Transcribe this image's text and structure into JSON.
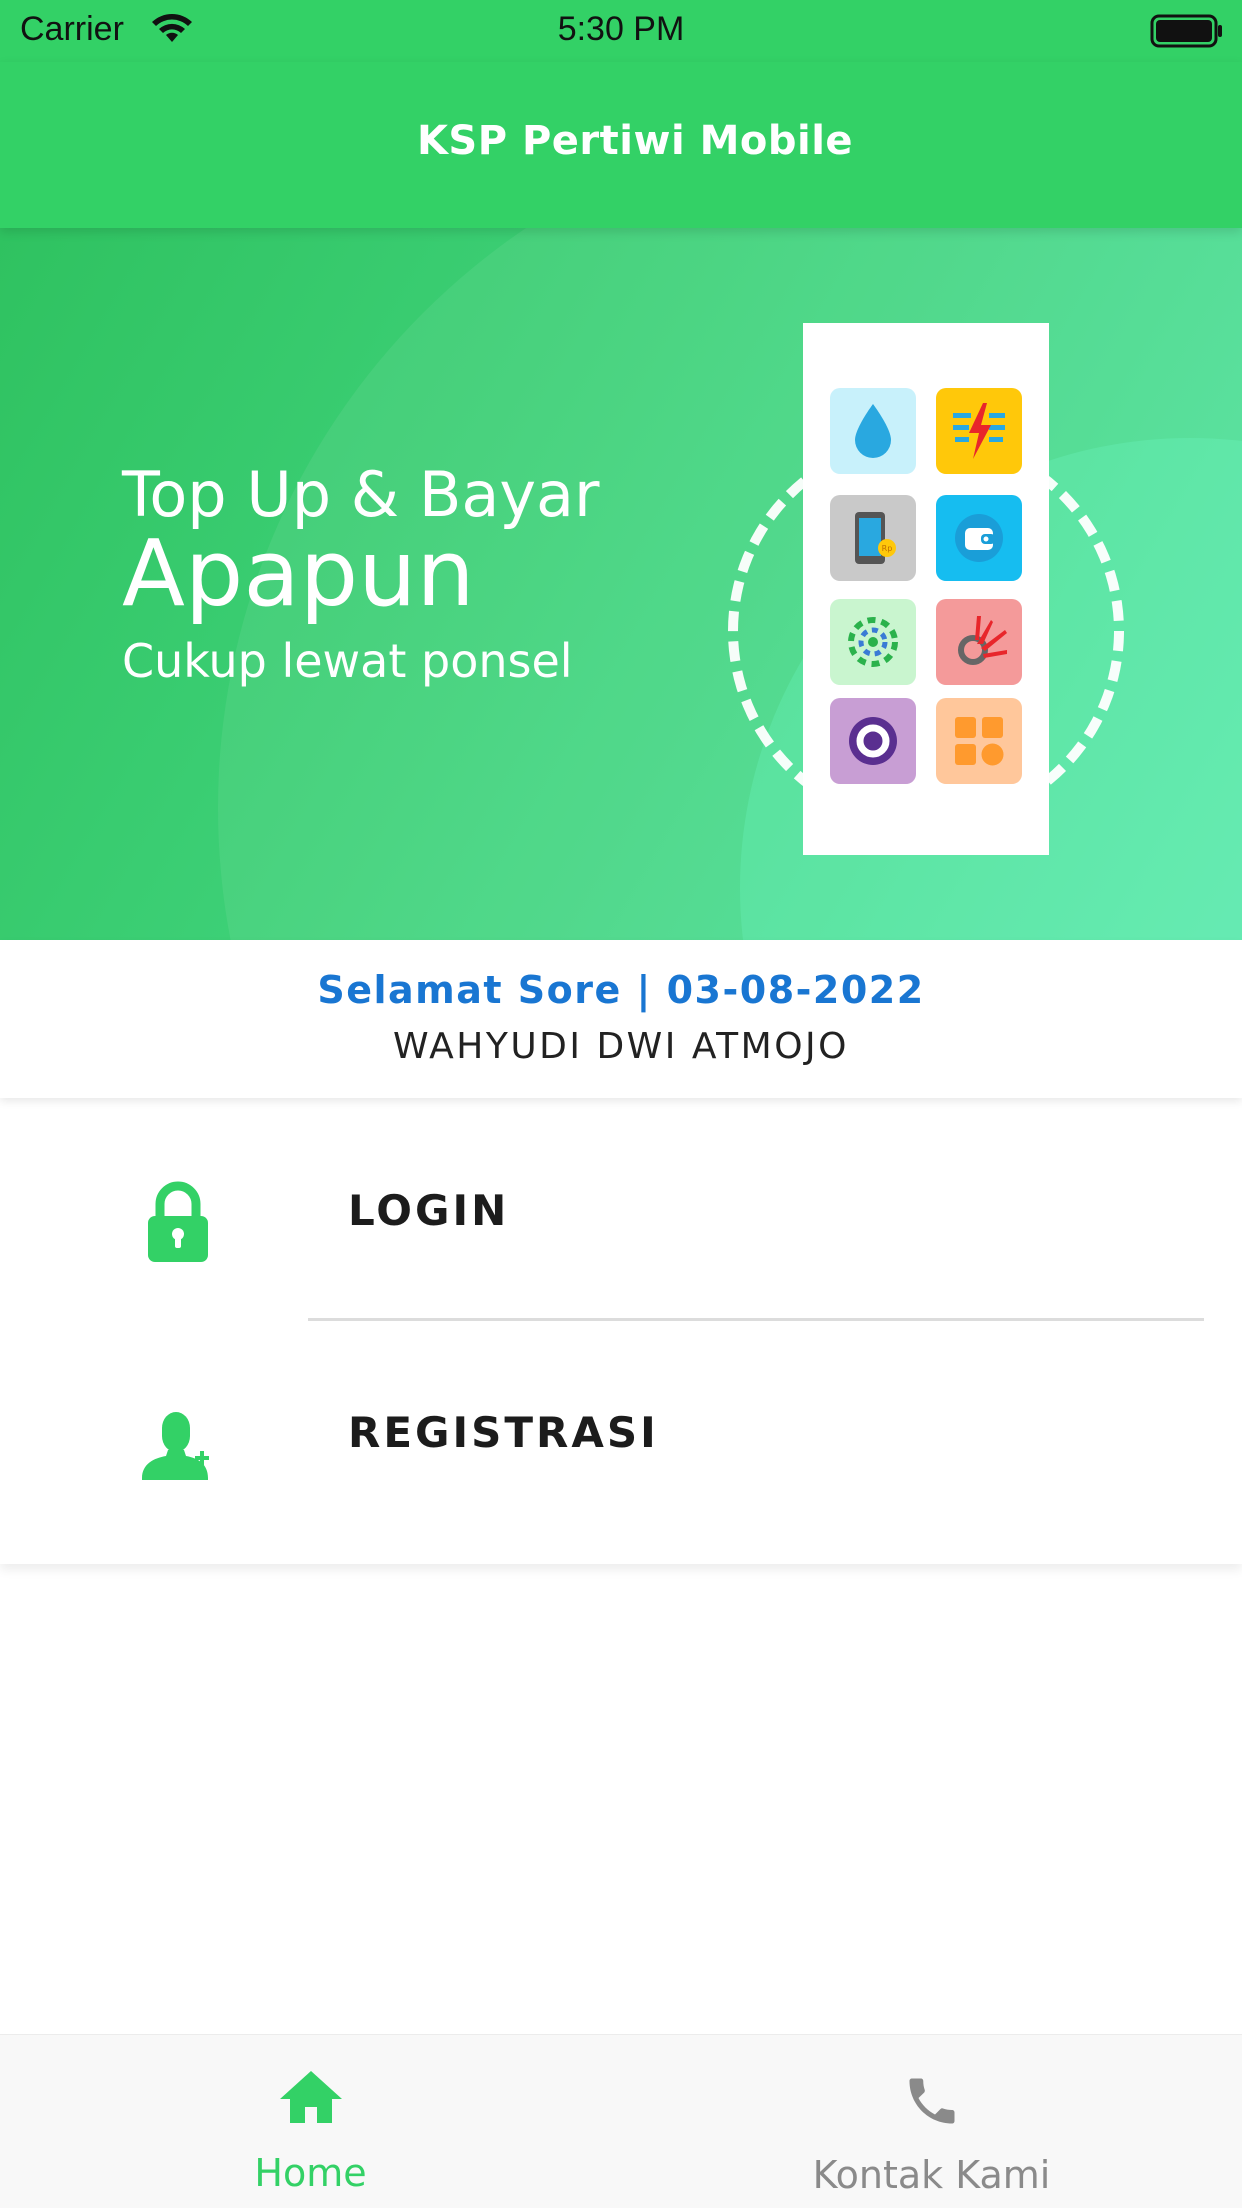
{
  "status_bar": {
    "carrier": "Carrier",
    "time": "5:30 PM"
  },
  "app_bar": {
    "title": "KSP Pertiwi Mobile"
  },
  "banner": {
    "line1": "Top Up & Bayar",
    "line2": "Apapun",
    "line3": "Cukup lewat ponsel",
    "tile_icons": [
      "water-drop-icon",
      "electricity-icon",
      "phone-credit-icon",
      "wallet-icon",
      "bpjs-icon",
      "telkom-icon",
      "ovo-icon",
      "apps-icon"
    ]
  },
  "greeting": {
    "salutation": "Selamat Sore | 03-08-2022",
    "user_name": "WAHYUDI DWI ATMOJO"
  },
  "menu": {
    "items": [
      {
        "label": "LOGIN",
        "icon": "lock-icon"
      },
      {
        "label": "REGISTRASI",
        "icon": "add-user-icon"
      }
    ]
  },
  "bottom_nav": {
    "items": [
      {
        "label": "Home",
        "icon": "home-icon",
        "active": true
      },
      {
        "label": "Kontak Kami",
        "icon": "phone-icon",
        "active": false
      }
    ]
  },
  "colors": {
    "primary_green": "#33d166",
    "greeting_blue": "#1976d2",
    "inactive_gray": "#8a8a8a"
  }
}
